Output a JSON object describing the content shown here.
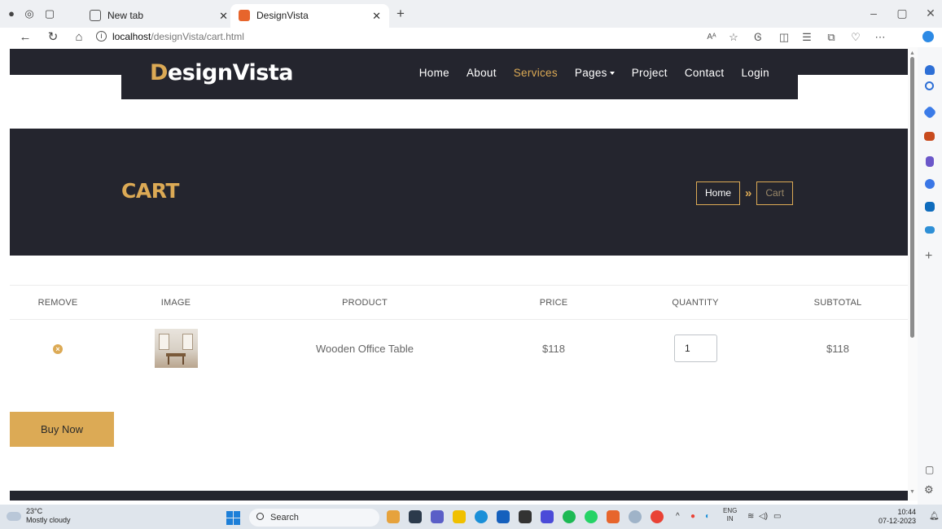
{
  "browser": {
    "tabs": [
      {
        "title": "New tab",
        "active": false
      },
      {
        "title": "DesignVista",
        "active": true
      }
    ],
    "url_host": "localhost",
    "url_path": "/designVista/cart.html",
    "read_aloud_label": "Aᴬ",
    "new_tab_glyph": "+"
  },
  "site": {
    "logo_first": "D",
    "logo_rest": "esignVista",
    "nav": [
      "Home",
      "About",
      "Services",
      "Pages",
      "Project",
      "Contact",
      "Login"
    ],
    "active_nav": "Services",
    "accent_color": "#dcaa55",
    "dark_color": "#24252e"
  },
  "hero": {
    "title": "CART",
    "breadcrumb_home": "Home",
    "breadcrumb_sep": "»",
    "breadcrumb_current": "Cart"
  },
  "cart": {
    "headers": [
      "REMOVE",
      "IMAGE",
      "PRODUCT",
      "PRICE",
      "QUANTITY",
      "SUBTOTAL"
    ],
    "rows": [
      {
        "product": "Wooden Office Table",
        "price": "$118",
        "quantity": "1",
        "subtotal": "$118"
      }
    ],
    "buy_label": "Buy Now"
  },
  "taskbar": {
    "temperature": "23°C",
    "weather": "Mostly cloudy",
    "search_label": "Search",
    "lang_top": "ENG",
    "lang_bottom": "IN",
    "time": "10:44",
    "date": "07-12-2023"
  }
}
